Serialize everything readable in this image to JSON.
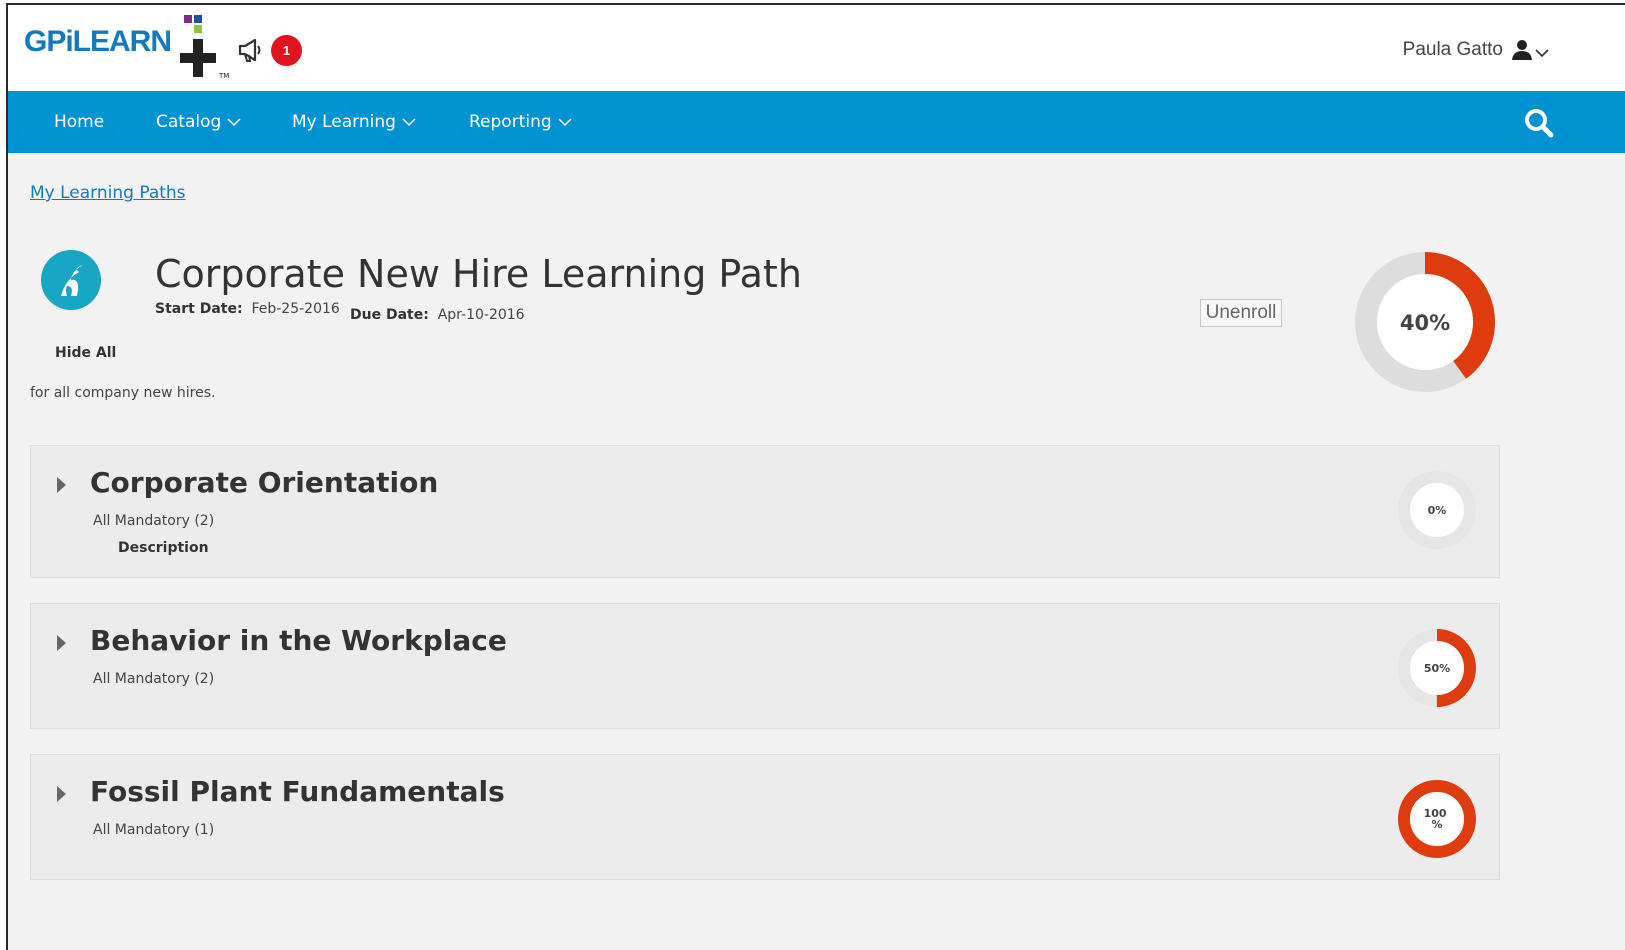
{
  "header": {
    "logo_text": "GPiLEARN",
    "logo_tm": "TM",
    "notifications_count": "1",
    "user_name": "Paula Gatto"
  },
  "nav": {
    "items": [
      {
        "label": "Home"
      },
      {
        "label": "Catalog"
      },
      {
        "label": "My Learning"
      },
      {
        "label": "Reporting"
      }
    ]
  },
  "breadcrumb": "My Learning Paths",
  "path": {
    "title": "Corporate New Hire Learning Path",
    "start_label": "Start Date:",
    "start_value": "Feb-25-2016",
    "due_label": "Due Date:",
    "due_value": "Apr-10-2016",
    "hide_all_label": "Hide All",
    "description": "for all company new hires.",
    "unenroll_label": "Unenroll",
    "progress_label": "40%",
    "progress": 0.4
  },
  "courses": [
    {
      "title": "Corporate Orientation",
      "subtitle": "All Mandatory (2)",
      "description_label": "Description",
      "progress_label": "0%",
      "progress": 0
    },
    {
      "title": "Behavior in the Workplace",
      "subtitle": "All Mandatory (2)",
      "progress_label": "50%",
      "progress": 0.5
    },
    {
      "title": "Fossil Plant Fundamentals",
      "subtitle": "All Mandatory (1)",
      "progress_label_line1": "100",
      "progress_label_line2": "%",
      "progress": 1
    }
  ],
  "colors": {
    "brand_blue": "#0092d1",
    "logo_blue": "#1479bd",
    "progress_red": "#de3b0f",
    "track_gray": "#dddddd",
    "badge_red": "#e0141e",
    "path_icon_teal": "#17a6c4"
  },
  "icons": {
    "announce": "megaphone-icon",
    "user": "user-icon",
    "search": "search-icon",
    "caret": "caret-right-icon",
    "path": "road-icon"
  }
}
